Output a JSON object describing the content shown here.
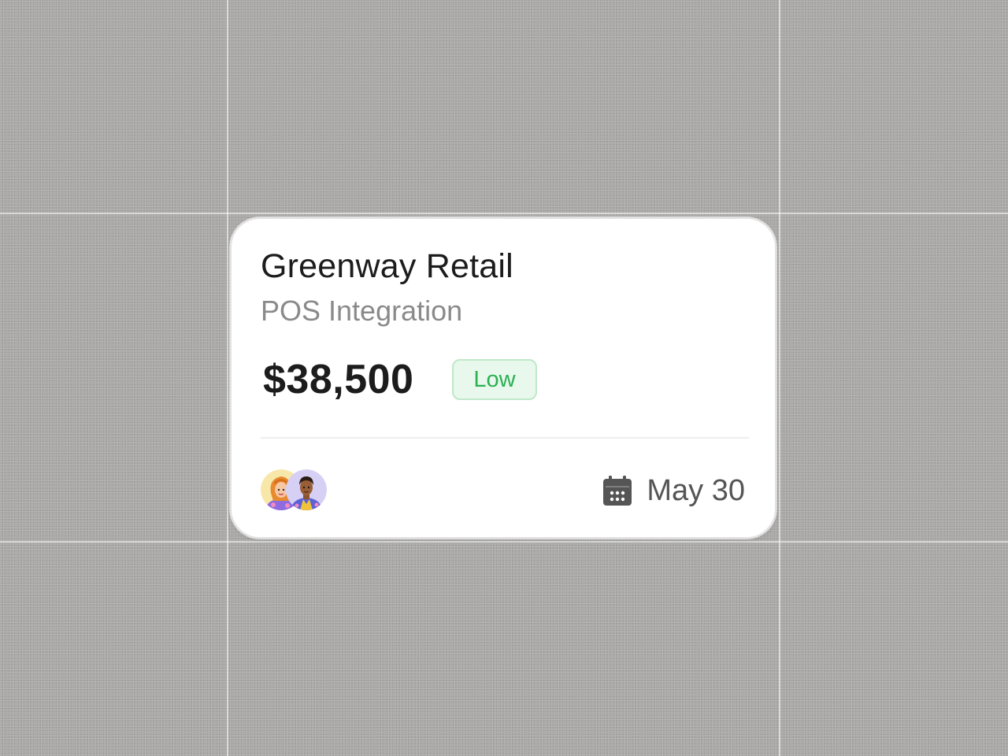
{
  "card": {
    "title": "Greenway Retail",
    "subtitle": "POS Integration",
    "amount": "$38,500",
    "priority": "Low",
    "due_date": "May 30",
    "due_icon": "calendar-icon",
    "assignees": [
      {
        "avatar": "avatar-woman-icon"
      },
      {
        "avatar": "avatar-man-icon"
      }
    ]
  },
  "colors": {
    "background": "#a9a8a7",
    "card": "#ffffff",
    "title": "#1c1c1c",
    "subtitle": "#8a8a8a",
    "badge_text": "#2bb052",
    "badge_bg": "#e8f8ec",
    "badge_border": "#bfe8c9",
    "date": "#555555"
  }
}
